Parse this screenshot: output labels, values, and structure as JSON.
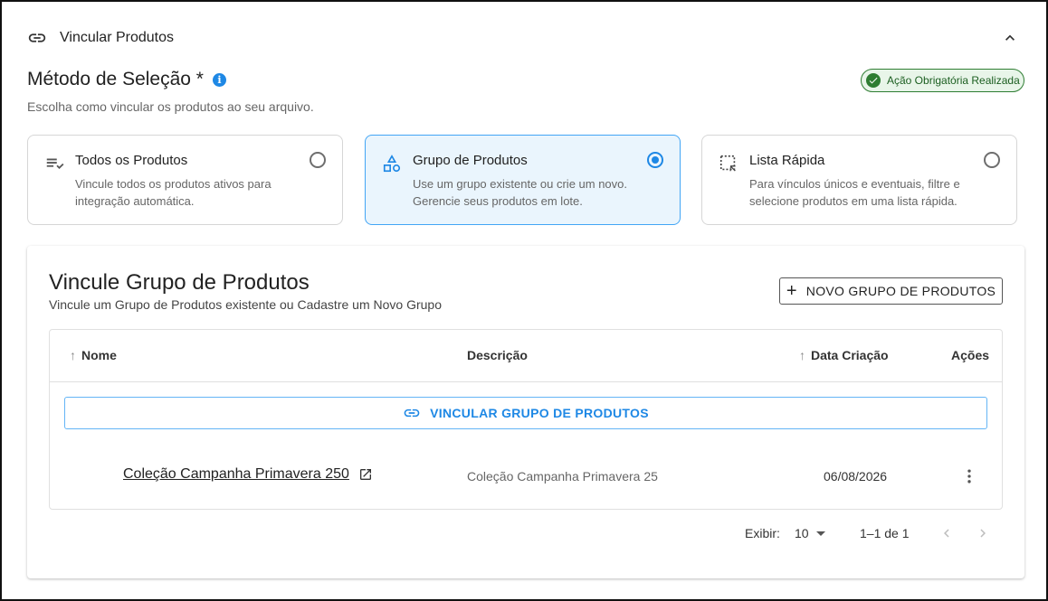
{
  "panel": {
    "title": "Vincular Produtos",
    "link_icon": "link-icon",
    "collapse_icon": "chevron-up-icon"
  },
  "selection": {
    "title": "Método de Seleção *",
    "info_icon": "info-icon",
    "subtitle": "Escolha como vincular os produtos ao seu arquivo.",
    "badge": {
      "text": "Ação Obrigatória Realizada",
      "icon": "check-circle-icon",
      "color": "#2e7d32"
    }
  },
  "methods": [
    {
      "title": "Todos os Produtos",
      "description": "Vincule todos os produtos ativos para integração automática.",
      "icon": "checklist-icon",
      "selected": false
    },
    {
      "title": "Grupo de Produtos",
      "description": "Use um grupo existente ou crie um novo. Gerencie seus produtos em lote.",
      "icon": "shapes-icon",
      "selected": true
    },
    {
      "title": "Lista Rápida",
      "description": "Para vínculos únicos e eventuais, filtre e selecione produtos em uma lista rápida.",
      "icon": "select-area-icon",
      "selected": false
    }
  ],
  "group_section": {
    "title": "Vincule Grupo de Produtos",
    "subtitle": "Vincule um Grupo de Produtos existente ou Cadastre um Novo Grupo",
    "new_button": "NOVO GRUPO DE PRODUTOS",
    "link_button": "VINCULAR GRUPO DE PRODUTOS",
    "columns": {
      "name": "Nome",
      "description": "Descrição",
      "date": "Data Criação",
      "actions": "Ações"
    },
    "rows": [
      {
        "name": "Coleção Campanha Primavera 250",
        "description": "Coleção Campanha Primavera 25",
        "date": "06/08/2026"
      }
    ],
    "pagination": {
      "label": "Exibir:",
      "per_page": "10",
      "range": "1–1 de 1"
    }
  },
  "colors": {
    "accent": "#1e88e5",
    "selected_bg": "#eaf5fd",
    "success": "#2e7d32"
  }
}
